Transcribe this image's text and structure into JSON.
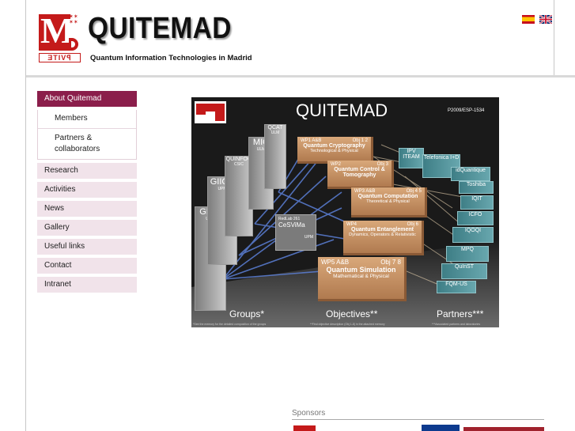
{
  "header": {
    "title": "QUITEMAD",
    "subtitle": "Quantum Information Technologies in Madrid",
    "logo_letter": "M",
    "logo_bottom": "ƎTIVꟼ",
    "languages": [
      "es",
      "en"
    ]
  },
  "sidebar": {
    "items": [
      {
        "label": "About Quitemad",
        "active": true
      },
      {
        "label": "Research"
      },
      {
        "label": "Activities"
      },
      {
        "label": "News"
      },
      {
        "label": "Gallery"
      },
      {
        "label": "Useful links"
      },
      {
        "label": "Contact"
      },
      {
        "label": "Intranet"
      }
    ],
    "subitems": [
      "Members",
      "Partners & collaborators"
    ]
  },
  "diagram": {
    "title": "QUITEMAD",
    "code": "P2009/ESP-1534",
    "sections": [
      "Groups*",
      "Objectives**",
      "Partners***"
    ],
    "groups": [
      "GICC",
      "GIICC",
      "QUINFOG",
      "MIC",
      "QCAT"
    ],
    "group_subs": [
      "UCM",
      "UPM",
      "CSIC",
      "ULM",
      "ULM"
    ],
    "middle": {
      "line1": "RedLab 261",
      "line2": "CeSViMa",
      "line3": "UPM"
    },
    "objectives": [
      {
        "wp": "WP1 A&B",
        "obj": "Obj 1 2",
        "main": "Quantum Cryptography",
        "desc": "Technological & Physical"
      },
      {
        "wp": "WP2",
        "obj": "Obj 3",
        "main": "Quantum Control & Tomography",
        "desc": ""
      },
      {
        "wp": "WP3 A&B",
        "obj": "Obj 4 5",
        "main": "Quantum Computation",
        "desc": "Theoretical & Physical"
      },
      {
        "wp": "WP4",
        "obj": "Obj 6",
        "main": "Quantum Entanglement",
        "desc": "Dynamics, Operators & Relativistic"
      },
      {
        "wp": "WP5 A&B",
        "obj": "Obj 7 8",
        "main": "Quantum Simulation",
        "desc": "Mathematical & Physical"
      }
    ],
    "partners": [
      "IPV ITEAM",
      "Telefonica I+D",
      "idQuantique",
      "Toshiba",
      "IQIT",
      "ICFO",
      "IQOQI",
      "MPQ",
      "QuInST",
      "FQM-US"
    ],
    "notes": [
      "*See the memory for the detailed composition of the groups",
      "**Find objective description (Obj 1-8) in the attached memory",
      "***Associated partners and laboratories"
    ]
  },
  "sponsors": {
    "label": "Sponsors"
  },
  "colors": {
    "active_nav": "#8b1e4b",
    "nav_bg": "#f1e3ea",
    "brand_red": "#c41a1a"
  }
}
